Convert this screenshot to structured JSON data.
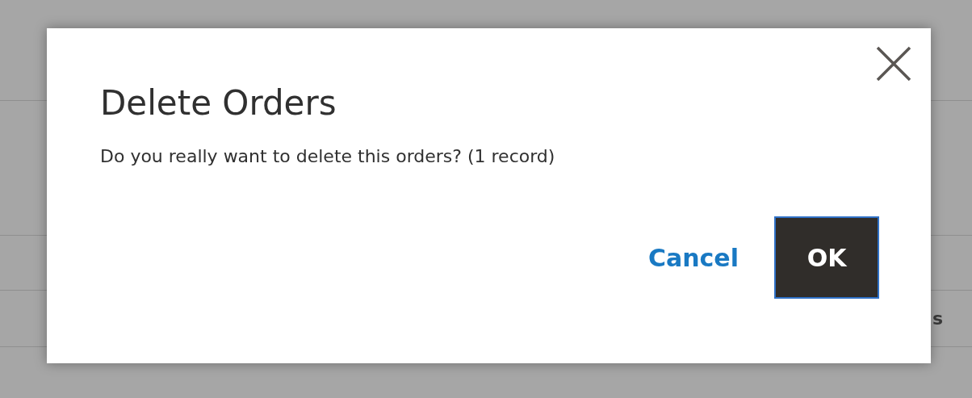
{
  "background": {
    "cell_text": "s"
  },
  "modal": {
    "title": "Delete Orders",
    "message": "Do you really want to delete this orders? (1 record)",
    "buttons": [
      {
        "label": "Cancel",
        "kind": "link",
        "focused": false
      },
      {
        "label": "OK",
        "kind": "primary",
        "focused": true
      }
    ]
  }
}
